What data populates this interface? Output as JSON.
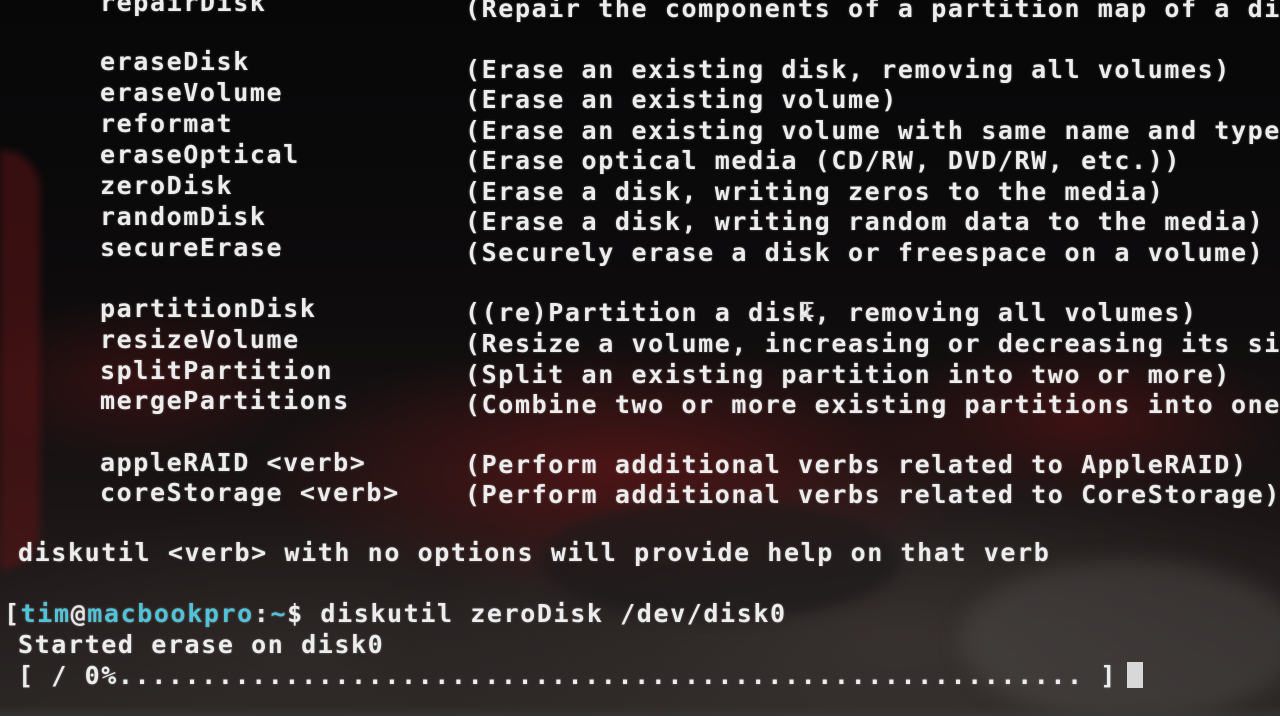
{
  "top_partial": {
    "cmd": "repairDisk",
    "desc": "(Repair the components of a partition map of a disk"
  },
  "erase_group": [
    {
      "cmd": "eraseDisk",
      "desc": "(Erase an existing disk, removing all volumes)"
    },
    {
      "cmd": "eraseVolume",
      "desc": "(Erase an existing volume)"
    },
    {
      "cmd": "reformat",
      "desc": "(Erase an existing volume with same name and type)"
    },
    {
      "cmd": "eraseOptical",
      "desc": "(Erase optical media (CD/RW, DVD/RW, etc.))"
    },
    {
      "cmd": "zeroDisk",
      "desc": "(Erase a disk, writing zeros to the media)"
    },
    {
      "cmd": "randomDisk",
      "desc": "(Erase a disk, writing random data to the media)"
    },
    {
      "cmd": "secureErase",
      "desc": "(Securely erase a disk or freespace on a volume)"
    }
  ],
  "partition_group": [
    {
      "cmd": "partitionDisk",
      "desc": "((re)Partition a disk, removing all volumes)"
    },
    {
      "cmd": "resizeVolume",
      "desc": "(Resize a volume, increasing or decreasing its size"
    },
    {
      "cmd": "splitPartition",
      "desc": "(Split an existing partition into two or more)"
    },
    {
      "cmd": "mergePartitions",
      "desc": "(Combine two or more existing partitions into one)"
    }
  ],
  "verb_group": [
    {
      "cmd": "appleRAID <verb>",
      "desc": "(Perform additional verbs related to AppleRAID)"
    },
    {
      "cmd": "coreStorage <verb>",
      "desc": "(Perform additional verbs related to CoreStorage)"
    }
  ],
  "help_hint": "diskutil <verb> with no options will provide help on that verb",
  "prompt": {
    "open_bracket": "[",
    "user": "tim",
    "at": "@",
    "host": "macbookpro",
    "sep": ":",
    "path": "~",
    "symbol": "$ ",
    "command": "diskutil zeroDisk /dev/disk0"
  },
  "output_line": "Started erase on disk0",
  "progress": {
    "text": "[ / 0%.......................................................... ]",
    "percent": 0
  },
  "colors": {
    "prompt_accent": "#4fc3d9",
    "text": "#ededed"
  }
}
